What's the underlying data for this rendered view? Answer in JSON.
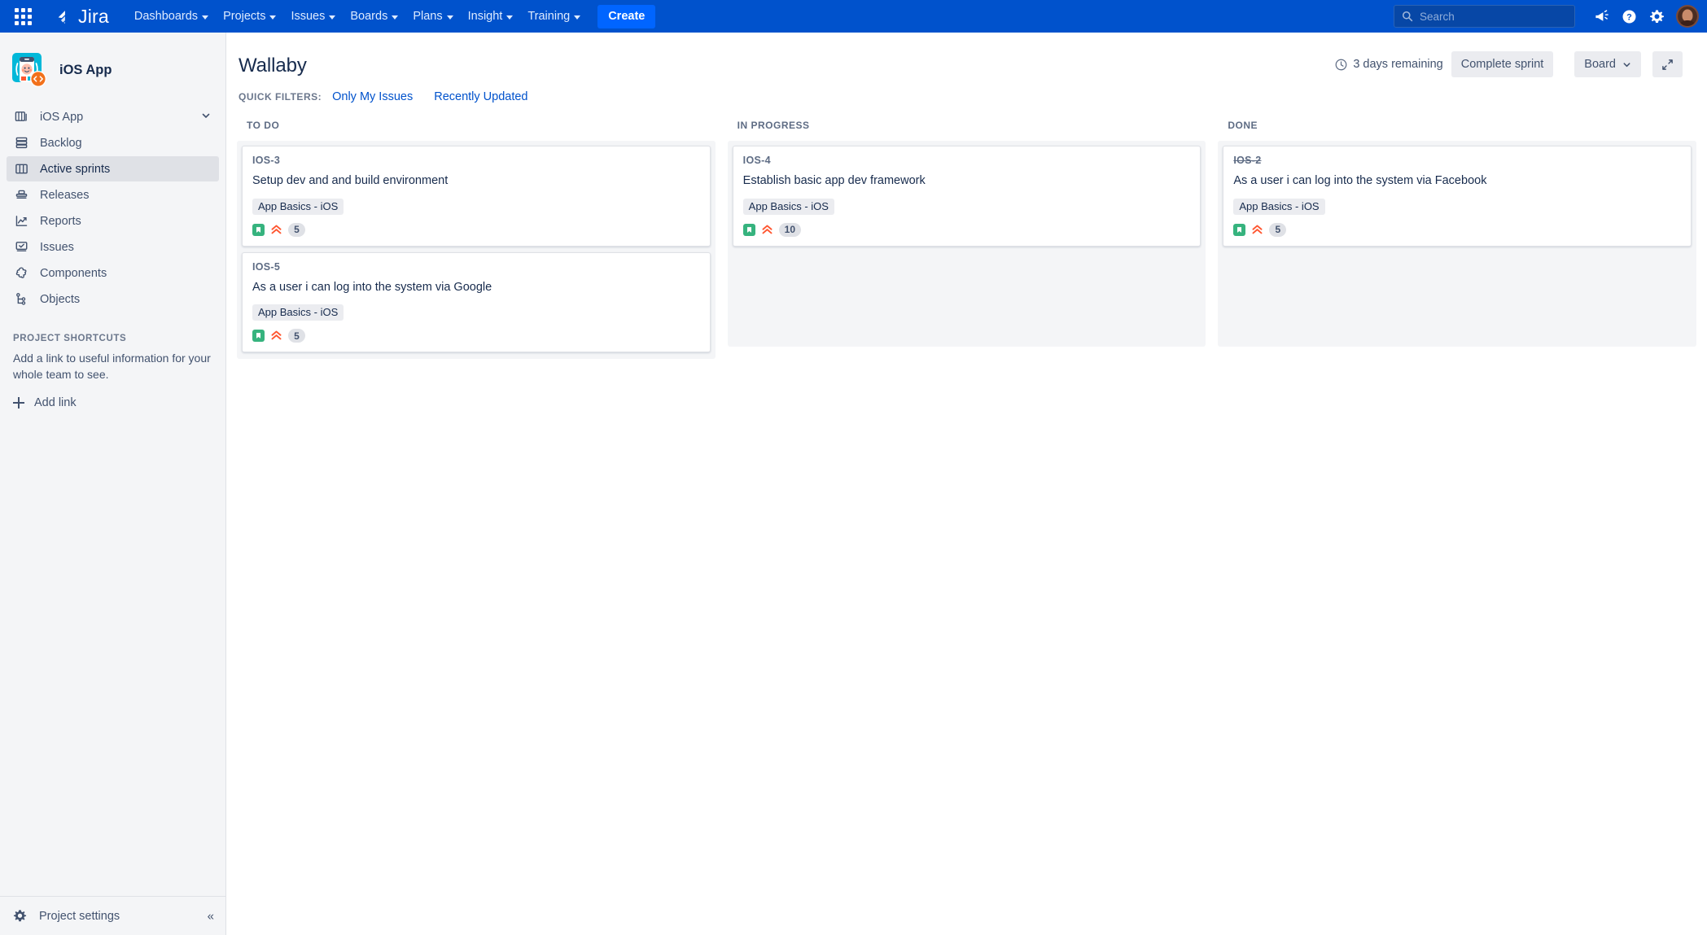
{
  "topnav": {
    "app_switcher_label": "App switcher",
    "logo_text": "Jira",
    "menu": [
      {
        "label": "Dashboards",
        "has_caret": true
      },
      {
        "label": "Projects",
        "has_caret": true
      },
      {
        "label": "Issues",
        "has_caret": true
      },
      {
        "label": "Boards",
        "has_caret": true
      },
      {
        "label": "Plans",
        "has_caret": true
      },
      {
        "label": "Insight",
        "has_caret": true
      },
      {
        "label": "Training",
        "has_caret": true
      }
    ],
    "create_label": "Create",
    "search_placeholder": "Search",
    "search_value": "",
    "icons": [
      "megaphone-icon",
      "help-icon",
      "settings-icon",
      "avatar"
    ],
    "brand_color": "#0052CC",
    "create_color": "#0065FF"
  },
  "sidebar": {
    "project_name": "iOS App",
    "items": [
      {
        "label": "iOS App",
        "icon": "board-stack-icon",
        "selected": false,
        "has_caret": true
      },
      {
        "label": "Backlog",
        "icon": "backlog-icon",
        "selected": false,
        "has_caret": false
      },
      {
        "label": "Active sprints",
        "icon": "columns-icon",
        "selected": true,
        "has_caret": false
      },
      {
        "label": "Releases",
        "icon": "releases-icon",
        "selected": false,
        "has_caret": false
      },
      {
        "label": "Reports",
        "icon": "reports-chart-icon",
        "selected": false,
        "has_caret": false
      },
      {
        "label": "Issues",
        "icon": "issues-icon",
        "selected": false,
        "has_caret": false
      },
      {
        "label": "Components",
        "icon": "components-puzzle-icon",
        "selected": false,
        "has_caret": false
      },
      {
        "label": "Objects",
        "icon": "objects-tree-icon",
        "selected": false,
        "has_caret": false
      }
    ],
    "shortcuts_title": "PROJECT SHORTCUTS",
    "shortcuts_desc": "Add a link to useful information for your whole team to see.",
    "add_link_label": "Add link",
    "project_settings_label": "Project settings",
    "collapse_label": "«"
  },
  "header": {
    "title": "Wallaby",
    "quick_filters_label": "QUICK FILTERS:",
    "quick_filters": [
      "Only My Issues",
      "Recently Updated"
    ],
    "days_remaining": "3 days remaining",
    "complete_sprint_label": "Complete sprint",
    "board_menu_label": "Board",
    "fullscreen_label": "Fullscreen"
  },
  "board": {
    "columns": [
      {
        "name": "TO DO",
        "cards": [
          {
            "key": "IOS-3",
            "key_done": false,
            "summary": "Setup dev and and build environment",
            "epic": "App Basics - iOS",
            "type_icon": "story-icon",
            "priority_icon": "highest-priority-icon",
            "points": "5"
          },
          {
            "key": "IOS-5",
            "key_done": false,
            "summary": "As a user i can log into the system via Google",
            "epic": "App Basics - iOS",
            "type_icon": "story-icon",
            "priority_icon": "highest-priority-icon",
            "points": "5"
          }
        ]
      },
      {
        "name": "IN PROGRESS",
        "cards": [
          {
            "key": "IOS-4",
            "key_done": false,
            "summary": "Establish basic app dev framework",
            "epic": "App Basics - iOS",
            "type_icon": "story-icon",
            "priority_icon": "highest-priority-icon",
            "points": "10"
          }
        ]
      },
      {
        "name": "DONE",
        "cards": [
          {
            "key": "IOS-2",
            "key_done": true,
            "summary": "As a user i can log into the system via Facebook",
            "epic": "App Basics - iOS",
            "type_icon": "story-icon",
            "priority_icon": "highest-priority-icon",
            "points": "5"
          }
        ]
      }
    ]
  },
  "colors": {
    "nav_blue": "#0052CC",
    "link_blue": "#0052CC",
    "story_green": "#36B37E",
    "priority_red": "#FF5630",
    "surface_gray": "#F4F5F7",
    "text_dark": "#172B4D"
  }
}
